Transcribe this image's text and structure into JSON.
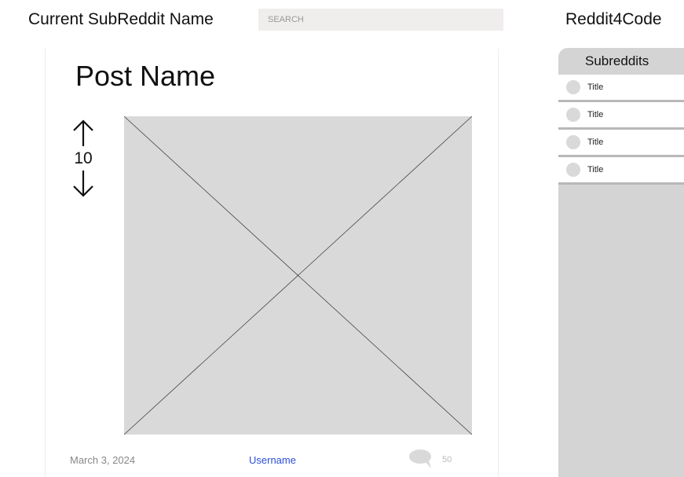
{
  "header": {
    "subreddit_name": "Current SubReddit Name",
    "search_placeholder": "SEARCH",
    "brand": "Reddit4Code"
  },
  "post": {
    "title": "Post Name",
    "votes": "10",
    "date": "March 3, 2024",
    "username": "Username",
    "comment_count": "50"
  },
  "sidebar": {
    "title": "Subreddits",
    "items": [
      {
        "label": "Title"
      },
      {
        "label": "Title"
      },
      {
        "label": "Title"
      },
      {
        "label": "Title"
      }
    ]
  },
  "colors": {
    "link": "#2a4fd6",
    "sidebar_bg": "#d4d4d4",
    "search_bg": "#f0eded",
    "placeholder_bg": "#d9d9d9"
  },
  "icons": [
    "up-arrow-icon",
    "down-arrow-icon",
    "comment-icon",
    "image-placeholder-icon",
    "avatar-dot-icon"
  ]
}
